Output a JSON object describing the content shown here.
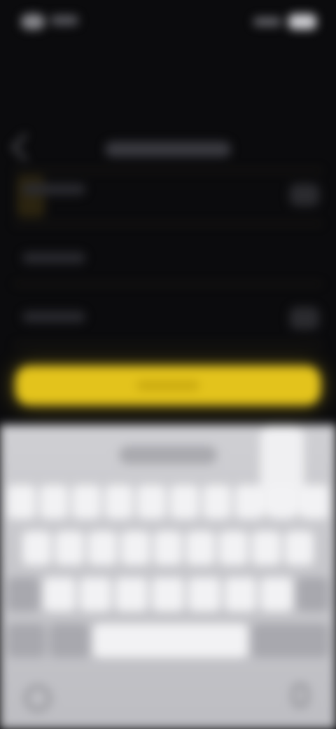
{
  "status_bar": {
    "time": "",
    "icons": [
      "signal-icon",
      "wifi-icon",
      "battery-icon"
    ]
  },
  "header": {
    "title": "",
    "back_icon": "chevron-left-icon"
  },
  "form": {
    "amount_label": "",
    "address_label": "",
    "note_label": "",
    "accent_color": "#e3c31c"
  },
  "action": {
    "confirm_label": ""
  },
  "keyboard": {
    "suggestion": "",
    "rows": [
      [
        "",
        "",
        "",
        "",
        "",
        "",
        "",
        "",
        "",
        ""
      ],
      [
        "",
        "",
        "",
        "",
        "",
        "",
        "",
        "",
        ""
      ],
      [
        "",
        "",
        "",
        "",
        "",
        "",
        "",
        "",
        ""
      ],
      [
        "",
        "",
        "",
        ""
      ]
    ],
    "icons": [
      "globe-icon",
      "microphone-icon"
    ]
  }
}
